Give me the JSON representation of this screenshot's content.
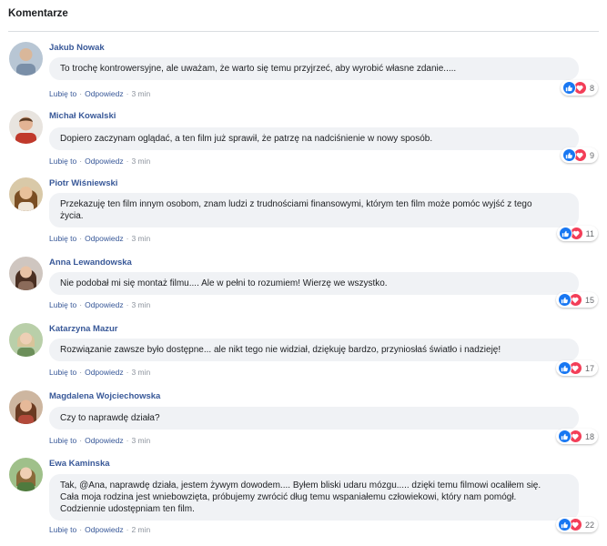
{
  "header": {
    "title": "Komentarze"
  },
  "actions": {
    "like": "Lubię to",
    "reply": "Odpowiedz",
    "separator": "·"
  },
  "colors": {
    "link": "#385898",
    "bubble": "#f0f2f5",
    "like": "#1877f2",
    "love": "#f33e58"
  },
  "comments": [
    {
      "author": "Jakub Nowak",
      "text": "To trochę kontrowersyjne, ale uważam, że warto się temu przyjrzeć, aby wyrobić własne zdanie.....",
      "time": "3 min",
      "reactions": "8"
    },
    {
      "author": "Michał Kowalski",
      "text": "Dopiero zaczynam oglądać, a ten film już sprawił, że patrzę na nadciśnienie w nowy sposób.",
      "time": "3 min",
      "reactions": "9"
    },
    {
      "author": "Piotr Wiśniewski",
      "text": "Przekazuję ten film innym osobom, znam ludzi z trudnościami finansowymi, którym ten film może pomóc wyjść z tego\nżycia.",
      "time": "3 min",
      "reactions": "11"
    },
    {
      "author": "Anna Lewandowska",
      "text": "Nie podobał mi się montaż filmu.... Ale w pełni to rozumiem! Wierzę we wszystko.",
      "time": "3 min",
      "reactions": "15"
    },
    {
      "author": "Katarzyna Mazur",
      "text": "Rozwiązanie zawsze było dostępne... ale nikt tego nie widział, dziękuję bardzo, przyniosłaś światło i nadzieję!",
      "time": "3 min",
      "reactions": "17"
    },
    {
      "author": "Magdalena Wojciechowska",
      "text": "Czy to naprawdę działa?",
      "time": "3 min",
      "reactions": "18"
    },
    {
      "author": "Ewa Kaminska",
      "text": "Tak, @Ana, naprawdę działa, jestem żywym dowodem.... Byłem bliski udaru mózgu..... dzięki temu filmowi ocaliłem się.\nCała moja rodzina jest wniebowzięta, próbujemy zwrócić dług temu wspaniałemu człowiekowi, który nam pomógł.\nCodziennie udostępniam ten film.",
      "time": "2 min",
      "reactions": "22"
    }
  ]
}
